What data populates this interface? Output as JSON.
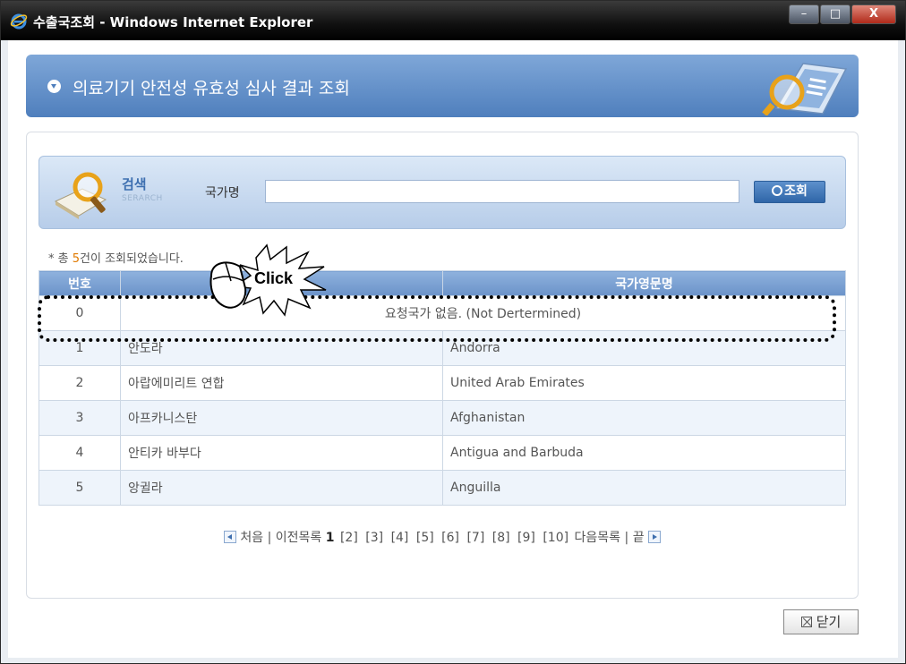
{
  "window": {
    "title": "수출국조회 - Windows Internet Explorer",
    "controls": {
      "minimize": "–",
      "maximize": "□",
      "close": "X"
    }
  },
  "banner": {
    "title": "의료기기 안전성 유효성 심사 결과 조회"
  },
  "search": {
    "label": "검색",
    "sublabel": "SERARCH",
    "field_label": "국가명",
    "input_value": "",
    "button_label": "조회"
  },
  "results": {
    "prefix": "* 총 ",
    "count": "5",
    "suffix": "건이 조회되었습니다."
  },
  "table": {
    "headers": [
      "번호",
      "",
      "국가영문명"
    ],
    "rows": [
      {
        "no": "0",
        "kr": "",
        "en": "요청국가 없음. (Not Dertermined)"
      },
      {
        "no": "1",
        "kr": "안도라",
        "en": "Andorra"
      },
      {
        "no": "2",
        "kr": "아랍에미리트 연합",
        "en": "United Arab Emirates"
      },
      {
        "no": "3",
        "kr": "아프카니스탄",
        "en": "Afghanistan"
      },
      {
        "no": "4",
        "kr": "안티카 바부다",
        "en": "Antigua and Barbuda"
      },
      {
        "no": "5",
        "kr": "앙귈라",
        "en": "Anguilla"
      }
    ]
  },
  "pager": {
    "first": "처음",
    "sep1": "|",
    "prev_list": "이전목록",
    "current": "1",
    "pages": [
      "[2]",
      "[3]",
      "[4]",
      "[5]",
      "[6]",
      "[7]",
      "[8]",
      "[9]",
      "[10]"
    ],
    "next_list": "다음목록",
    "sep2": "|",
    "last": "끝"
  },
  "close_button": {
    "label": "닫기"
  },
  "annotation": {
    "click_label": "Click"
  },
  "colors": {
    "banner": "#4f7fbd",
    "header": "#6b93c9",
    "accent": "#e07a00"
  }
}
